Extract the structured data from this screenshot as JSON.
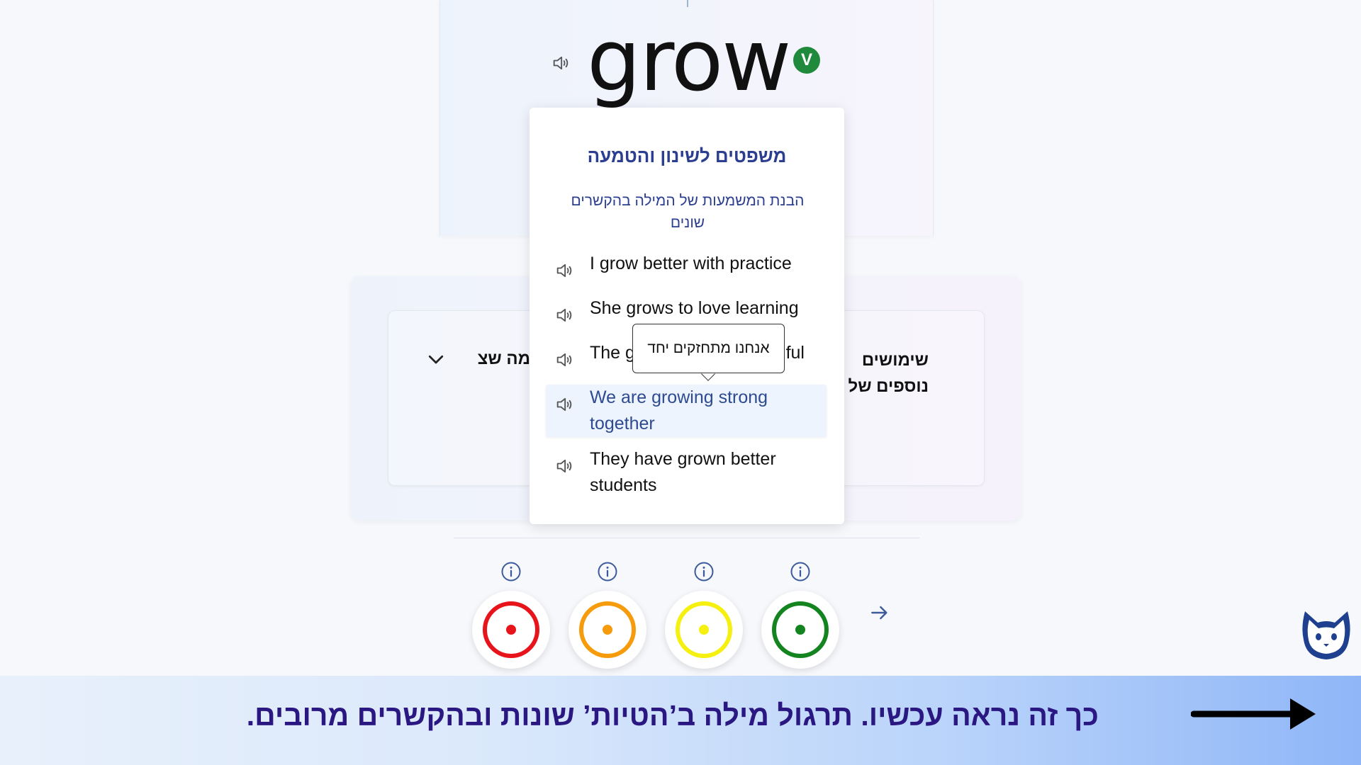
{
  "word_card": {
    "word": "grow",
    "verified_badge": "V"
  },
  "inner_panel": {
    "left_heading": "מה שצריך לדעת",
    "right_heading": "שימושים נוספים של המילה"
  },
  "popover": {
    "title": "משפטים לשינון והטמעה",
    "subtitle": "הבנת המשמעות של המילה בהקשרים שונים",
    "sentences": [
      {
        "text": "I grow better with practice"
      },
      {
        "text": "She grows to love learning"
      },
      {
        "text": "The garden grows beautiful"
      },
      {
        "text": "We are growing strong together"
      },
      {
        "text": "They have grown better students"
      }
    ],
    "tooltip_translation": "אנחנו מתחזקים יחד"
  },
  "rating": {
    "colors": [
      "#e8141b",
      "#f59b0c",
      "#f5f00f",
      "#13841f"
    ]
  },
  "banner": {
    "text": "כך זה נראה עכשיו. תרגול מילה ב’הטיות’ שונות ובהקשרים מרובים."
  }
}
